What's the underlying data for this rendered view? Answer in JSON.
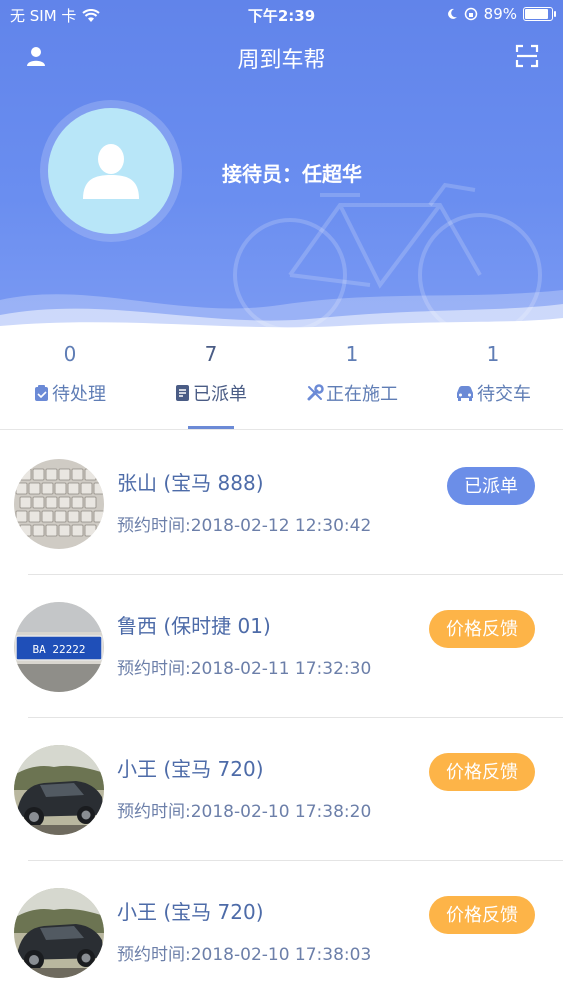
{
  "status_bar": {
    "carrier": "无 SIM 卡",
    "time": "下午2:39",
    "battery_percent": "89%",
    "battery_level": 0.89
  },
  "nav": {
    "title": "周到车帮",
    "left_icon": "user-icon",
    "right_icon": "scan-icon"
  },
  "profile": {
    "receptionist_label": "接待员：任超华"
  },
  "tabs": [
    {
      "count": "0",
      "label": "待处理",
      "icon": "clipboard-icon"
    },
    {
      "count": "7",
      "label": "已派单",
      "icon": "document-icon",
      "active": true
    },
    {
      "count": "1",
      "label": "正在施工",
      "icon": "wrench-icon"
    },
    {
      "count": "1",
      "label": "待交车",
      "icon": "car-icon"
    }
  ],
  "orders": [
    {
      "title": "张山 (宝马 888)",
      "time": "预约时间:2018-02-12 12:30:42",
      "status": "已派单",
      "status_color": "#6b8ee8",
      "thumb": "keyboard-photo"
    },
    {
      "title": "鲁西 (保时捷 01)",
      "time": "预约时间:2018-02-11 17:32:30",
      "status": "价格反馈",
      "status_color": "#fdb448",
      "thumb": "license-plate-photo",
      "plate_text": "BA 22222"
    },
    {
      "title": "小王 (宝马 720)",
      "time": "预约时间:2018-02-10 17:38:20",
      "status": "价格反馈",
      "status_color": "#fdb448",
      "thumb": "car-photo"
    },
    {
      "title": "小王 (宝马 720)",
      "time": "预约时间:2018-02-10 17:38:03",
      "status": "价格反馈",
      "status_color": "#fdb448",
      "thumb": "car-photo"
    }
  ],
  "colors": {
    "header_blue": "#6184ea",
    "accent_blue": "#6b8ee8",
    "accent_orange": "#fdb448"
  }
}
